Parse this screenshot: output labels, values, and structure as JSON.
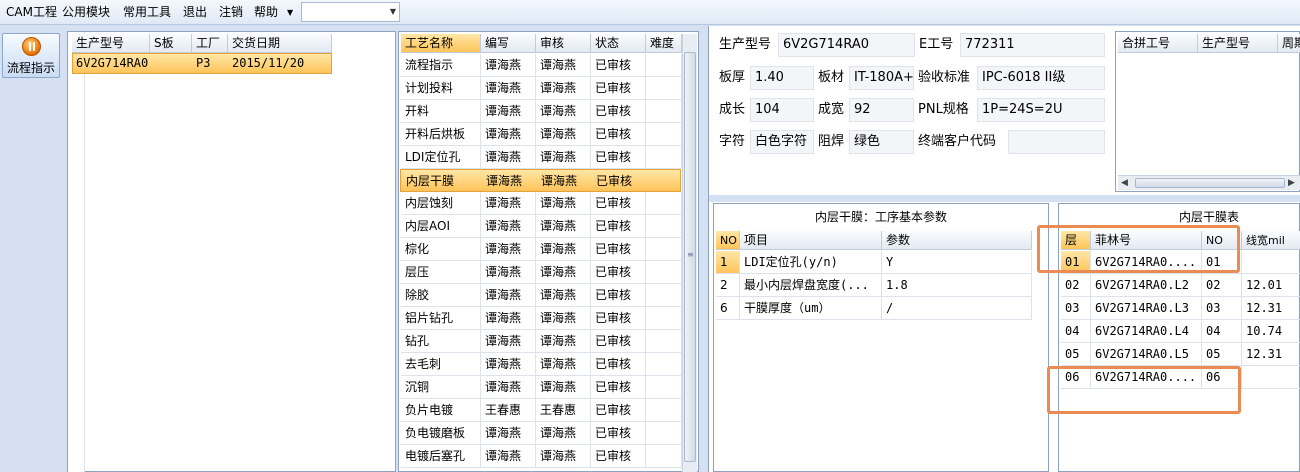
{
  "menu": {
    "items": [
      "CAM工程",
      "公用模块",
      "常用工具",
      "退出",
      "注销",
      "帮助"
    ],
    "combo_value": ""
  },
  "sidebar": {
    "flow_button_label": "流程指示"
  },
  "orders": {
    "headers": [
      "生产型号",
      "S板",
      "工厂",
      "交货日期"
    ],
    "rows": [
      {
        "model": "6V2G714RA0",
        "s": "",
        "factory": "P3",
        "date": "2015/11/20",
        "selected": true
      }
    ]
  },
  "process": {
    "headers": [
      "工艺名称",
      "编写",
      "审核",
      "状态",
      "难度"
    ],
    "rows": [
      [
        "流程指示",
        "谭海燕",
        "谭海燕",
        "已审核",
        ""
      ],
      [
        "计划投料",
        "谭海燕",
        "谭海燕",
        "已审核",
        ""
      ],
      [
        "开料",
        "谭海燕",
        "谭海燕",
        "已审核",
        ""
      ],
      [
        "开料后烘板",
        "谭海燕",
        "谭海燕",
        "已审核",
        ""
      ],
      [
        "LDI定位孔",
        "谭海燕",
        "谭海燕",
        "已审核",
        ""
      ],
      [
        "内层干膜",
        "谭海燕",
        "谭海燕",
        "已审核",
        ""
      ],
      [
        "内层蚀刻",
        "谭海燕",
        "谭海燕",
        "已审核",
        ""
      ],
      [
        "内层AOI",
        "谭海燕",
        "谭海燕",
        "已审核",
        ""
      ],
      [
        "棕化",
        "谭海燕",
        "谭海燕",
        "已审核",
        ""
      ],
      [
        "层压",
        "谭海燕",
        "谭海燕",
        "已审核",
        ""
      ],
      [
        "除胶",
        "谭海燕",
        "谭海燕",
        "已审核",
        ""
      ],
      [
        "铝片钻孔",
        "谭海燕",
        "谭海燕",
        "已审核",
        ""
      ],
      [
        "钻孔",
        "谭海燕",
        "谭海燕",
        "已审核",
        ""
      ],
      [
        "去毛刺",
        "谭海燕",
        "谭海燕",
        "已审核",
        ""
      ],
      [
        "沉铜",
        "谭海燕",
        "谭海燕",
        "已审核",
        ""
      ],
      [
        "负片电镀",
        "王春惠",
        "王春惠",
        "已审核",
        ""
      ],
      [
        "负电镀磨板",
        "谭海燕",
        "谭海燕",
        "已审核",
        ""
      ],
      [
        "电镀后塞孔",
        "谭海燕",
        "谭海燕",
        "已审核",
        ""
      ]
    ],
    "selected_index": 5
  },
  "info": {
    "model_label": "生产型号",
    "model": "6V2G714RA0",
    "e_label": "E工号",
    "e_no": "772311",
    "thick_label": "板厚",
    "thick": "1.40",
    "material_label": "板材",
    "material": "IT-180A+",
    "standard_label": "验收标准",
    "standard": "IPC-6018 II级",
    "length_label": "成长",
    "length": "104",
    "width_label": "成宽",
    "width": "92",
    "pnl_label": "PNL规格",
    "pnl": "1P=24S=2U",
    "char_label": "字符",
    "char": "白色字符",
    "mask_label": "阻焊",
    "mask": "绿色",
    "customer_label": "终端客户代码",
    "customer": ""
  },
  "merge": {
    "headers": [
      "合拼工号",
      "生产型号",
      "周期"
    ]
  },
  "params": {
    "title": "内层干膜：工序基本参数",
    "headers": [
      "NO",
      "项目",
      "参数"
    ],
    "rows": [
      [
        "1",
        "LDI定位孔(y/n)",
        "Y"
      ],
      [
        "2",
        "最小内层焊盘宽度(...",
        "1.8"
      ],
      [
        "6",
        "干膜厚度（um）",
        "/"
      ]
    ]
  },
  "layers": {
    "title": "内层干膜表",
    "headers": [
      "层",
      "菲林号",
      "NO",
      "线宽mil"
    ],
    "rows": [
      [
        "01",
        "6V2G714RA0....",
        "01",
        ""
      ],
      [
        "02",
        "6V2G714RA0.L2",
        "02",
        "12.01"
      ],
      [
        "03",
        "6V2G714RA0.L3",
        "03",
        "12.31"
      ],
      [
        "04",
        "6V2G714RA0.L4",
        "04",
        "10.74"
      ],
      [
        "05",
        "6V2G714RA0.L5",
        "05",
        "12.31"
      ],
      [
        "06",
        "6V2G714RA0....",
        "06",
        ""
      ]
    ]
  },
  "colors": {
    "accent_highlight": "#e98b52",
    "selected_row": "#ffc45a",
    "app_bg": "#d5e1f2"
  }
}
